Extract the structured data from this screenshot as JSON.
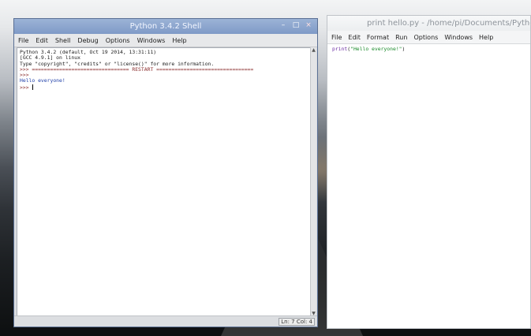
{
  "shell": {
    "title": "Python 3.4.2 Shell",
    "controls": {
      "minimize": "–",
      "maximize": "□",
      "close": "×"
    },
    "menu": [
      "File",
      "Edit",
      "Shell",
      "Debug",
      "Options",
      "Windows",
      "Help"
    ],
    "lines": [
      "Python 3.4.2 (default, Oct 19 2014, 13:31:11)",
      "[GCC 4.9.1] on linux",
      "Type \"copyright\", \"credits\" or \"license()\" for more information.",
      ">>> ================================ RESTART ================================",
      ">>>",
      "Hello everyone!",
      ">>> "
    ],
    "status": "Ln: 7 Col: 4",
    "scrollbar": {
      "up_arrow": "▲",
      "down_arrow": "▼"
    }
  },
  "editor": {
    "title": "print hello.py - /home/pi/Documents/Python Code/",
    "menu": [
      "File",
      "Edit",
      "Format",
      "Run",
      "Options",
      "Windows",
      "Help"
    ],
    "code": {
      "func": "print",
      "open": "(",
      "string": "\"Hello everyone!\"",
      "close": ")"
    }
  },
  "colors": {
    "shell_titlebar": "#8ea7d0",
    "prompt": "#8b2f2f",
    "output": "#1f3fa8",
    "builtin": "#6b2ca3",
    "string": "#1a8a2a"
  }
}
